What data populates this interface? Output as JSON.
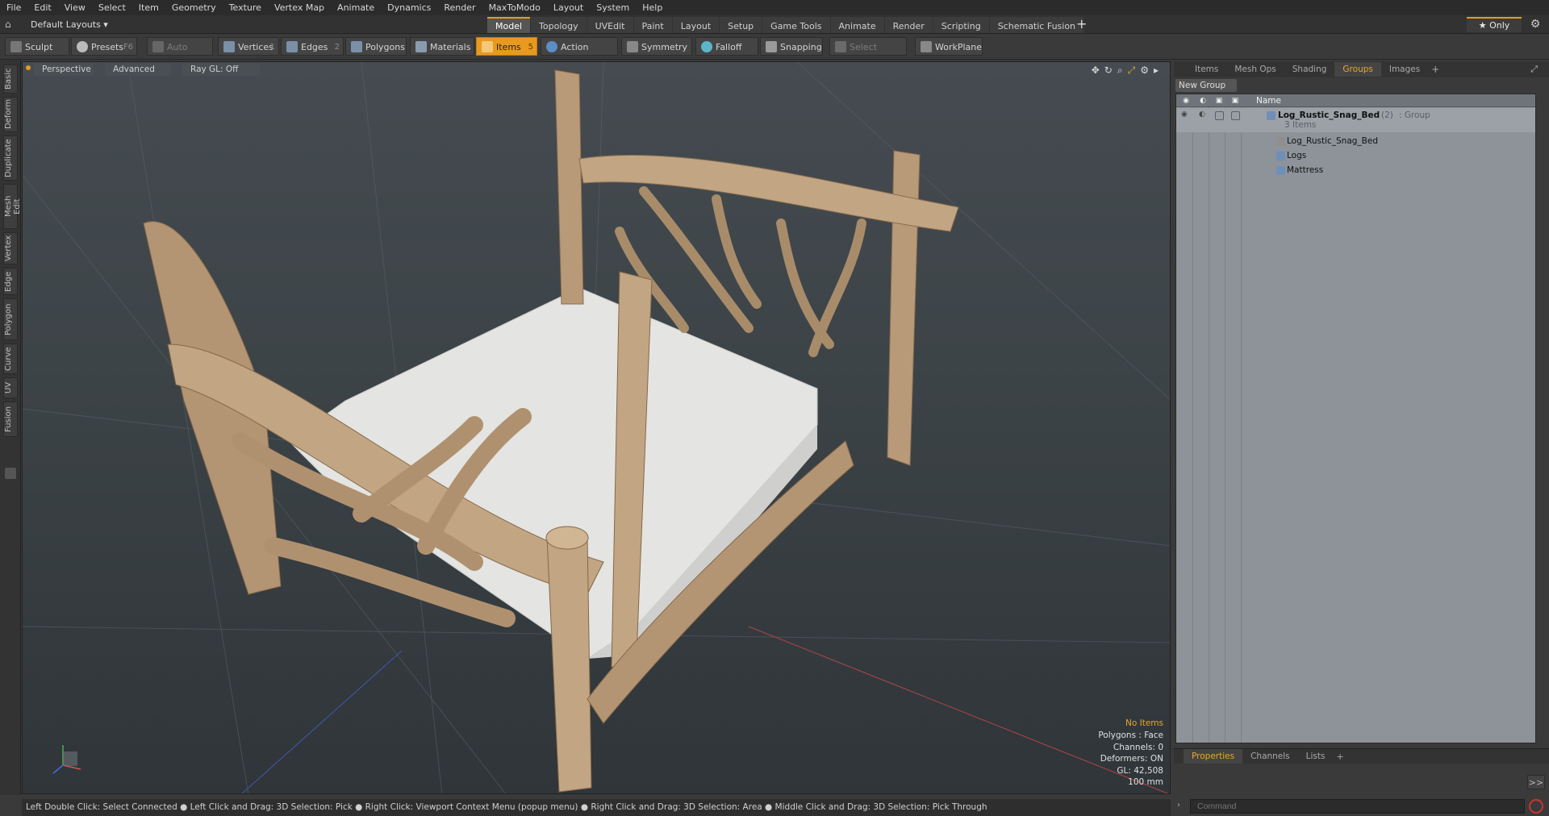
{
  "menubar": [
    "File",
    "Edit",
    "View",
    "Select",
    "Item",
    "Geometry",
    "Texture",
    "Vertex Map",
    "Animate",
    "Dynamics",
    "Render",
    "MaxToModo",
    "Layout",
    "System",
    "Help"
  ],
  "layout_selector": "Default Layouts ▾",
  "layout_tabs": [
    "Model",
    "Topology",
    "UVEdit",
    "Paint",
    "Layout",
    "Setup",
    "Game Tools",
    "Animate",
    "Render",
    "Scripting",
    "Schematic Fusion"
  ],
  "active_layout_tab": "Model",
  "only_label": "★ Only",
  "toolbar": {
    "sculpt": "Sculpt",
    "presets": "Presets",
    "presets_key": "F6",
    "auto_select": "Auto Select",
    "vertices": "Vertices",
    "vertices_key": "1",
    "edges": "Edges",
    "edges_key": "2",
    "polygons": "Polygons",
    "materials": "Materials",
    "items": "Items",
    "items_key": "5",
    "action_center": "Action Center",
    "symmetry": "Symmetry",
    "falloff": "Falloff",
    "snapping": "Snapping",
    "select_through": "Select Through",
    "workplane": "WorkPlane"
  },
  "left_tabs": [
    "Basic",
    "Deform",
    "Duplicate",
    "Mesh Edit",
    "Vertex",
    "Edge",
    "Polygon",
    "Curve",
    "UV",
    "Fusion"
  ],
  "viewport": {
    "view": "Perspective",
    "shading": "Advanced",
    "raygl": "Ray GL: Off",
    "info": {
      "no_items": "No Items",
      "polygons": "Polygons : Face",
      "channels": "Channels: 0",
      "deformers": "Deformers: ON",
      "gl": "GL: 42,508",
      "scale": "100 mm"
    }
  },
  "statusbar": "Left Double Click: Select Connected ● Left Click and Drag: 3D Selection: Pick ● Right Click: Viewport Context Menu (popup menu) ● Right Click and Drag: 3D Selection: Area ● Middle Click and Drag: 3D Selection: Pick Through",
  "right_panel": {
    "tabs": [
      "Items",
      "Mesh Ops",
      "Shading",
      "Groups",
      "Images"
    ],
    "active_tab": "Groups",
    "new_group": "New Group",
    "column_name": "Name",
    "tree": {
      "group_name": "Log_Rustic_Snag_Bed",
      "group_count": "(2)",
      "group_type": ": Group",
      "group_items": "3 Items",
      "children": [
        "Log_Rustic_Snag_Bed",
        "Logs",
        "Mattress"
      ]
    },
    "bottom_tabs": [
      "Properties",
      "Channels",
      "Lists"
    ],
    "active_bottom_tab": "Properties",
    "command_placeholder": "Command",
    "expand": ">>"
  },
  "colors": {
    "accent": "#e89a1f",
    "wood": "#b89a78",
    "mattress": "#e4e4e2"
  }
}
